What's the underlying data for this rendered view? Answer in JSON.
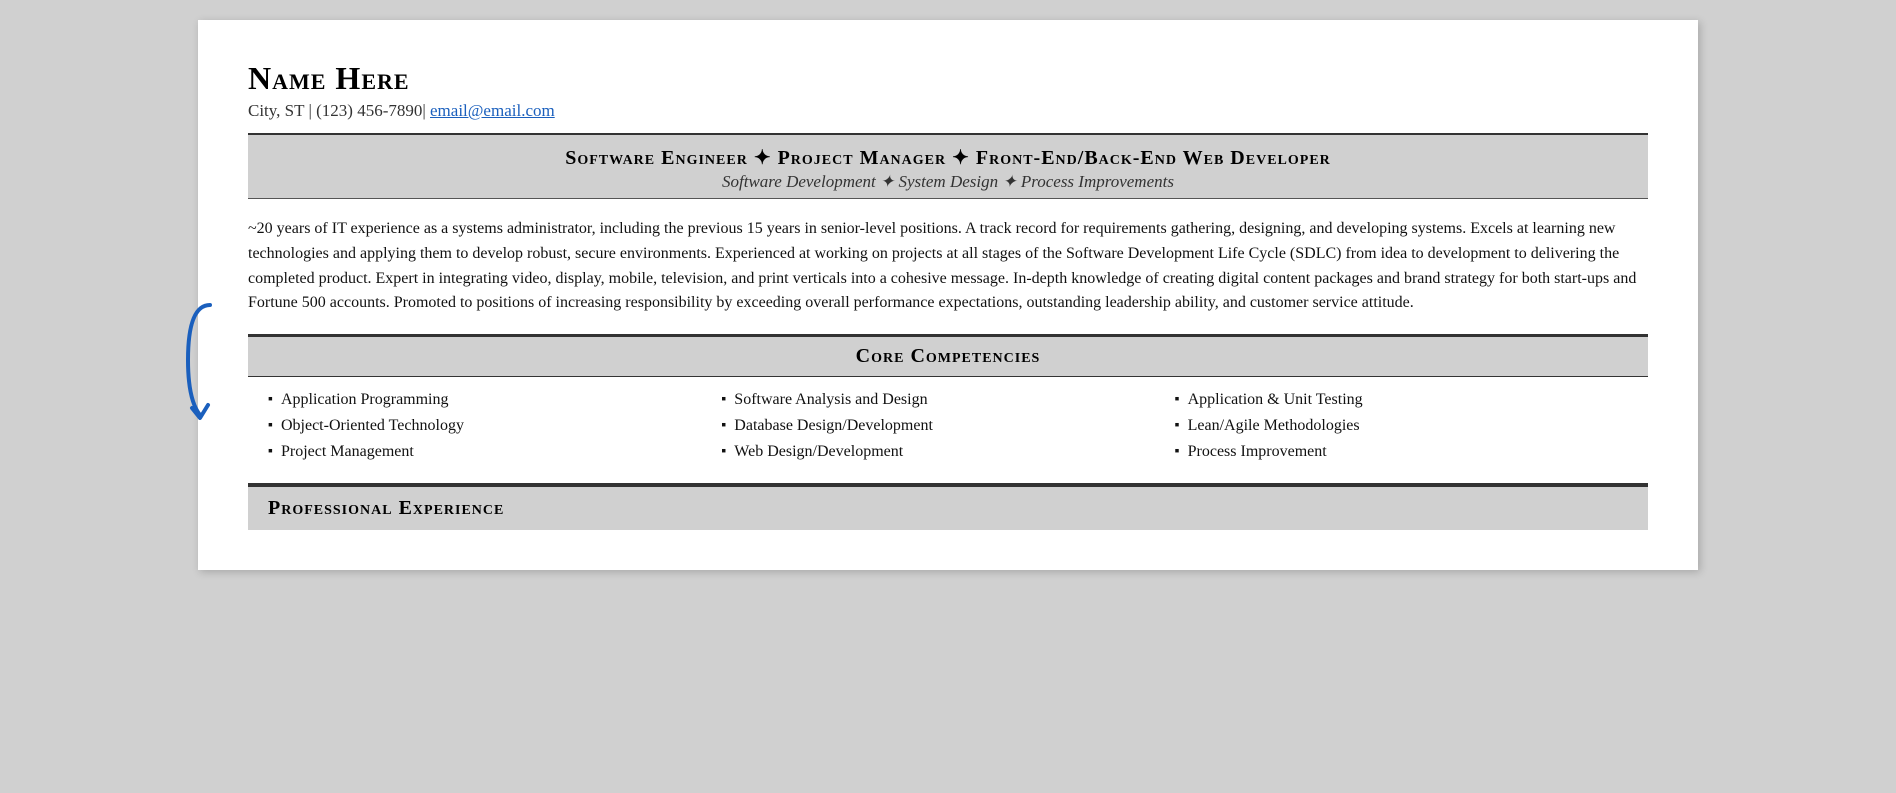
{
  "header": {
    "name": "Name Here",
    "contact": "City, ST | (123) 456-7890|",
    "email_label": "email@email.com",
    "email_href": "mailto:email@email.com"
  },
  "title_banner": {
    "main": "Software Engineer ✦ Project Manager ✦ Front-End/Back-End Web Developer",
    "sub": "Software Development ✦ System Design ✦ Process Improvements"
  },
  "summary": {
    "text": "~20 years of IT experience as a systems administrator, including the previous 15 years in senior-level positions. A track record for requirements gathering, designing, and developing systems. Excels at learning new technologies and applying them to develop robust, secure environments. Experienced at working on projects at all stages of the Software Development Life Cycle (SDLC) from idea to development to delivering the completed product. Expert in integrating video, display, mobile, television, and print verticals into a cohesive message. In-depth knowledge of creating digital content packages and brand strategy for both start-ups and Fortune 500 accounts. Promoted to positions of increasing responsibility by exceeding overall performance expectations, outstanding leadership ability, and customer service attitude."
  },
  "core_competencies": {
    "section_title": "Core Competencies",
    "columns": [
      {
        "items": [
          "Application Programming",
          "Object-Oriented Technology",
          "Project Management"
        ]
      },
      {
        "items": [
          "Software Analysis and Design",
          "Database Design/Development",
          "Web Design/Development"
        ]
      },
      {
        "items": [
          "Application & Unit Testing",
          "Lean/Agile Methodologies",
          "Process Improvement"
        ]
      }
    ]
  },
  "professional_experience": {
    "section_title": "Professional Experience"
  }
}
